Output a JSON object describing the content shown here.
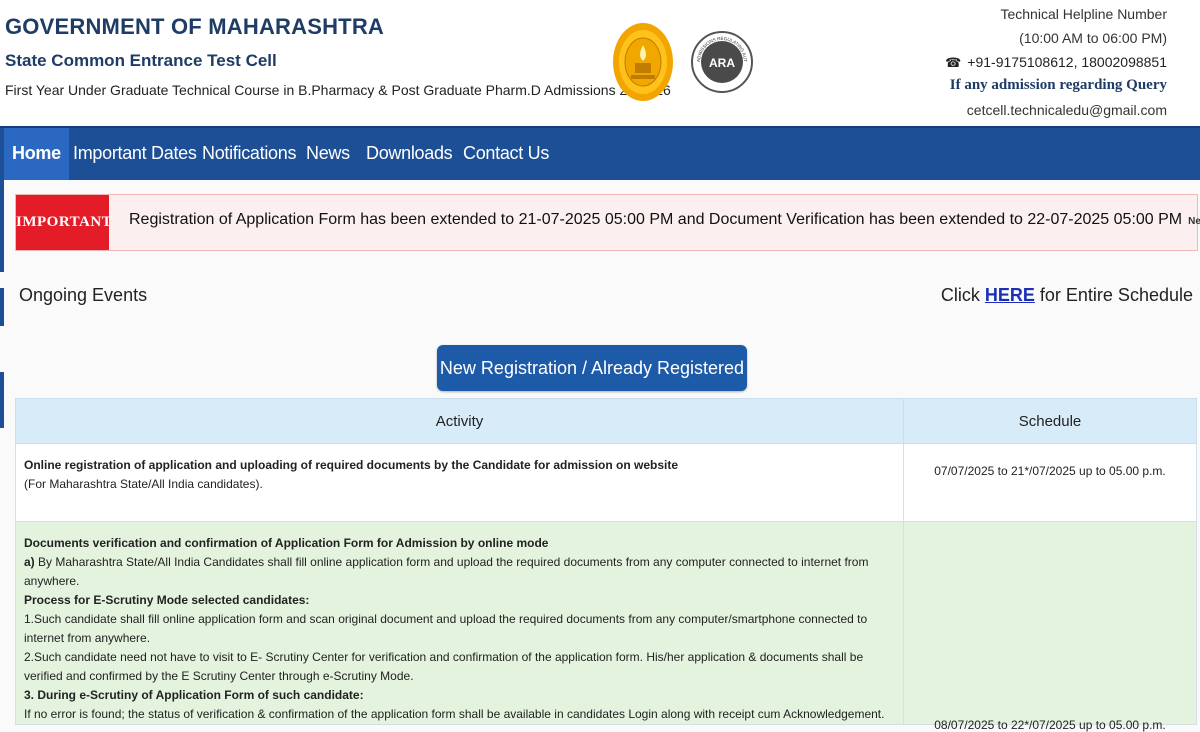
{
  "header": {
    "gov_title": "GOVERNMENT OF MAHARASHTRA",
    "cell_title": "State Common Entrance Test Cell",
    "course_title": "First Year Under Graduate Technical Course in B.Pharmacy & Post Graduate Pharm.D Admissions 2025-26",
    "ara_logo_text": "ARA",
    "ara_logo_ring": "ADMISSIONS REGULATING AUTHORITY • MAHARASHTRA",
    "helpline_title": "Technical Helpline Number",
    "helpline_hours": "(10:00 AM to 06:00 PM)",
    "phone_icon": "phone-icon",
    "helpline_phone": "+91-9175108612, 18002098851",
    "query_text": "If any admission regarding Query",
    "email": "cetcell.technicaledu@gmail.com"
  },
  "nav": {
    "items": [
      {
        "label": "Home",
        "active": true
      },
      {
        "label": "Important Dates"
      },
      {
        "label": "Notifications"
      },
      {
        "label": "News"
      },
      {
        "label": "Downloads"
      },
      {
        "label": "Contact Us"
      }
    ],
    "color": "#1c4f96",
    "active_color": "#2a68c2"
  },
  "alert": {
    "badge": "IMPORTANT",
    "text": "Registration of Application Form has been extended to 21-07-2025 05:00 PM and Document Verification has been extended to 22-07-2025 05:00 PM",
    "new_badge": "New",
    "diamond": "◆",
    "badge_color": "#e41c28"
  },
  "events": {
    "title": "Ongoing Events",
    "click_prefix": "Click",
    "click_link": "HERE",
    "click_suffix": "for Entire Schedule",
    "register_button": "New Registration / Already Registered"
  },
  "table": {
    "headers": [
      "Activity",
      "Schedule"
    ],
    "row1": {
      "title": "Online registration of application and uploading of required documents by the Candidate for admission on website",
      "subtitle": "(For Maharashtra State/All India candidates).",
      "schedule": "07/07/2025 to 21*/07/2025 up to 05.00 p.m."
    },
    "row2": {
      "title": "Documents verification and confirmation of Application Form for Admission by online mode",
      "a_label": "a)",
      "a_text": "By Maharashtra State/All India Candidates shall fill online application form and upload the required documents from any computer connected to internet from anywhere.",
      "process_title": "Process for E-Scrutiny Mode selected candidates:",
      "p1": "1.Such candidate shall fill online application form and scan original document and upload the required documents from any computer/smartphone connected to internet from anywhere.",
      "p2": "2.Such candidate need not have to visit to E- Scrutiny Center for verification and confirmation of the application form. His/her application & documents shall be verified and confirmed by the E Scrutiny Center through e-Scrutiny Mode.",
      "p3_title": "3. During e-Scrutiny of Application Form of such candidate:",
      "p3_text": "If no error is found; the status of verification & confirmation of the application form shall be available in candidates Login along with receipt cum Acknowledgement.",
      "schedule": "08/07/2025 to 22*/07/2025 up to 05.00 p.m."
    }
  }
}
